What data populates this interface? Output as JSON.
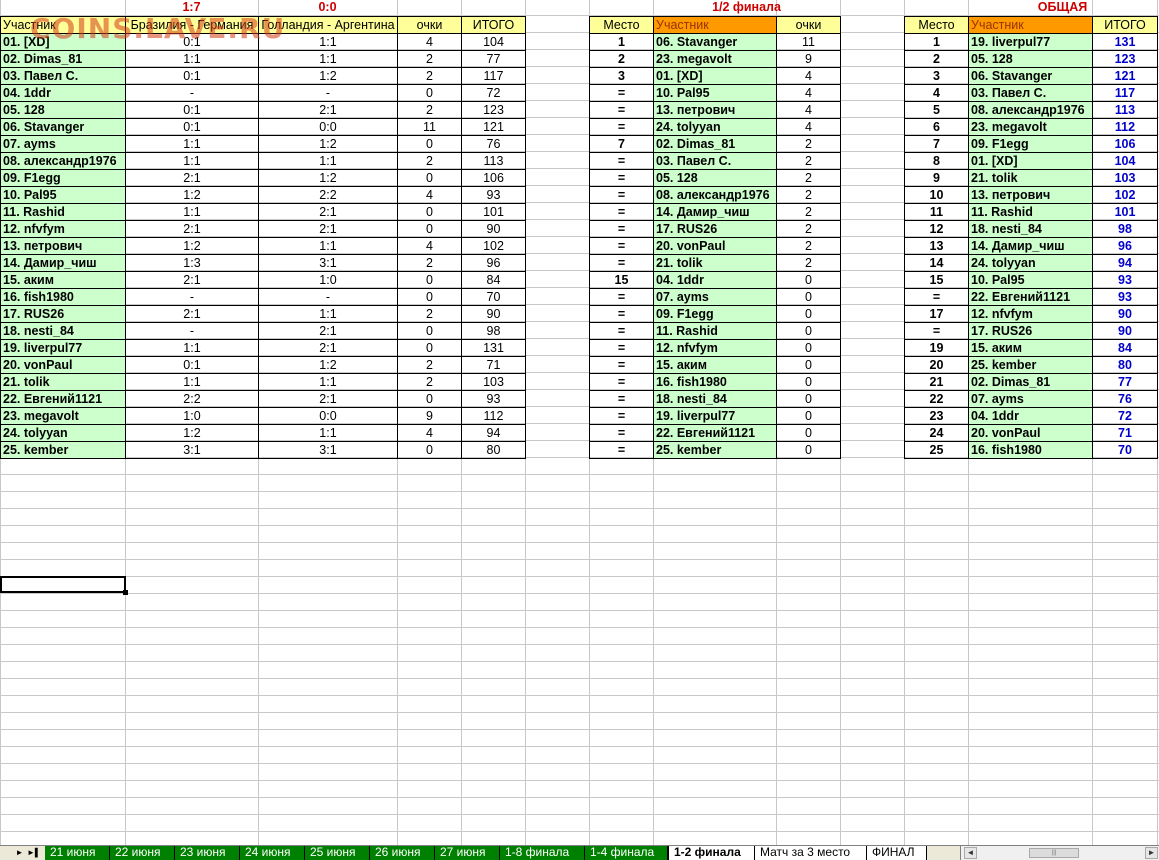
{
  "watermark": "COINS.LAVE.RU",
  "left": {
    "match1_score": "1:7",
    "match2_score": "0:0",
    "headers": [
      "Участник",
      "Бразилия - Германия",
      "Голландия - Аргентина",
      "очки",
      "ИТОГО"
    ],
    "rows": [
      [
        "01. [XD]",
        "0:1",
        "1:1",
        "4",
        "104"
      ],
      [
        "02. Dimas_81",
        "1:1",
        "1:1",
        "2",
        "77"
      ],
      [
        "03. Павел С.",
        "0:1",
        "1:2",
        "2",
        "117"
      ],
      [
        "04. 1ddr",
        "-",
        "-",
        "0",
        "72"
      ],
      [
        "05. 128",
        "0:1",
        "2:1",
        "2",
        "123"
      ],
      [
        "06. Stavanger",
        "0:1",
        "0:0",
        "11",
        "121"
      ],
      [
        "07. ayms",
        "1:1",
        "1:2",
        "0",
        "76"
      ],
      [
        "08. александр1976",
        "1:1",
        "1:1",
        "2",
        "113"
      ],
      [
        "09. F1egg",
        "2:1",
        "1:2",
        "0",
        "106"
      ],
      [
        "10. Pal95",
        "1:2",
        "2:2",
        "4",
        "93"
      ],
      [
        "11. Rashid",
        "1:1",
        "2:1",
        "0",
        "101"
      ],
      [
        "12. nfvfym",
        "2:1",
        "2:1",
        "0",
        "90"
      ],
      [
        "13. петрович",
        "1:2",
        "1:1",
        "4",
        "102"
      ],
      [
        "14. Дамир_чиш",
        "1:3",
        "3:1",
        "2",
        "96"
      ],
      [
        "15. аким",
        "2:1",
        "1:0",
        "0",
        "84"
      ],
      [
        "16. fish1980",
        "-",
        "-",
        "0",
        "70"
      ],
      [
        "17. RUS26",
        "2:1",
        "1:1",
        "2",
        "90"
      ],
      [
        "18. nesti_84",
        "-",
        "2:1",
        "0",
        "98"
      ],
      [
        "19. liverpul77",
        "1:1",
        "2:1",
        "0",
        "131"
      ],
      [
        "20. vonPaul",
        "0:1",
        "1:2",
        "2",
        "71"
      ],
      [
        "21. tolik",
        "1:1",
        "1:1",
        "2",
        "103"
      ],
      [
        "22. Евгений1121",
        "2:2",
        "2:1",
        "0",
        "93"
      ],
      [
        "23. megavolt",
        "1:0",
        "0:0",
        "9",
        "112"
      ],
      [
        "24. tolyyan",
        "1:2",
        "1:1",
        "4",
        "94"
      ],
      [
        "25. kember",
        "3:1",
        "3:1",
        "0",
        "80"
      ]
    ]
  },
  "middle": {
    "title": "1/2 финала",
    "headers": [
      "Место",
      "Участник",
      "очки"
    ],
    "rows": [
      [
        "1",
        "06. Stavanger",
        "11"
      ],
      [
        "2",
        "23. megavolt",
        "9"
      ],
      [
        "3",
        "01. [XD]",
        "4"
      ],
      [
        "=",
        "10. Pal95",
        "4"
      ],
      [
        "=",
        "13. петрович",
        "4"
      ],
      [
        "=",
        "24. tolyyan",
        "4"
      ],
      [
        "7",
        "02. Dimas_81",
        "2"
      ],
      [
        "=",
        "03. Павел С.",
        "2"
      ],
      [
        "=",
        "05. 128",
        "2"
      ],
      [
        "=",
        "08. александр1976",
        "2"
      ],
      [
        "=",
        "14. Дамир_чиш",
        "2"
      ],
      [
        "=",
        "17. RUS26",
        "2"
      ],
      [
        "=",
        "20. vonPaul",
        "2"
      ],
      [
        "=",
        "21. tolik",
        "2"
      ],
      [
        "15",
        "04. 1ddr",
        "0"
      ],
      [
        "=",
        "07. ayms",
        "0"
      ],
      [
        "=",
        "09. F1egg",
        "0"
      ],
      [
        "=",
        "11. Rashid",
        "0"
      ],
      [
        "=",
        "12. nfvfym",
        "0"
      ],
      [
        "=",
        "15. аким",
        "0"
      ],
      [
        "=",
        "16. fish1980",
        "0"
      ],
      [
        "=",
        "18. nesti_84",
        "0"
      ],
      [
        "=",
        "19. liverpul77",
        "0"
      ],
      [
        "=",
        "22. Евгений1121",
        "0"
      ],
      [
        "=",
        "25. kember",
        "0"
      ]
    ]
  },
  "right": {
    "title": "ОБЩАЯ",
    "headers": [
      "Место",
      "Участник",
      "ИТОГО"
    ],
    "rows": [
      [
        "1",
        "19. liverpul77",
        "131"
      ],
      [
        "2",
        "05. 128",
        "123"
      ],
      [
        "3",
        "06. Stavanger",
        "121"
      ],
      [
        "4",
        "03. Павел С.",
        "117"
      ],
      [
        "5",
        "08. александр1976",
        "113"
      ],
      [
        "6",
        "23. megavolt",
        "112"
      ],
      [
        "7",
        "09. F1egg",
        "106"
      ],
      [
        "8",
        "01. [XD]",
        "104"
      ],
      [
        "9",
        "21. tolik",
        "103"
      ],
      [
        "10",
        "13. петрович",
        "102"
      ],
      [
        "11",
        "11. Rashid",
        "101"
      ],
      [
        "12",
        "18. nesti_84",
        "98"
      ],
      [
        "13",
        "14. Дамир_чиш",
        "96"
      ],
      [
        "14",
        "24. tolyyan",
        "94"
      ],
      [
        "15",
        "10. Pal95",
        "93"
      ],
      [
        "=",
        "22. Евгений1121",
        "93"
      ],
      [
        "17",
        "12. nfvfym",
        "90"
      ],
      [
        "=",
        "17. RUS26",
        "90"
      ],
      [
        "19",
        "15. аким",
        "84"
      ],
      [
        "20",
        "25. kember",
        "80"
      ],
      [
        "21",
        "02. Dimas_81",
        "77"
      ],
      [
        "22",
        "07. ayms",
        "76"
      ],
      [
        "23",
        "04. 1ddr",
        "72"
      ],
      [
        "24",
        "20. vonPaul",
        "71"
      ],
      [
        "25",
        "16. fish1980",
        "70"
      ]
    ]
  },
  "tabs": [
    {
      "label": "21 июня",
      "state": "green"
    },
    {
      "label": "22 июня",
      "state": "green"
    },
    {
      "label": "23 июня",
      "state": "green"
    },
    {
      "label": "24 июня",
      "state": "green"
    },
    {
      "label": "25 июня",
      "state": "green"
    },
    {
      "label": "26 июня",
      "state": "green"
    },
    {
      "label": "27 июня",
      "state": "green"
    },
    {
      "label": "1-8 финала",
      "state": "green"
    },
    {
      "label": "1-4 финала",
      "state": "green"
    },
    {
      "label": "1-2 финала",
      "state": "active"
    },
    {
      "label": "Матч за 3 место",
      "state": "plain"
    },
    {
      "label": "ФИНАЛ",
      "state": "plain"
    }
  ],
  "colors": {
    "header_yellow": "#ffff99",
    "green_cell": "#ccffcc",
    "orange_header": "#ff9900",
    "title_red": "#cc0000",
    "total_blue": "#0000cc",
    "tab_green": "#008000"
  }
}
